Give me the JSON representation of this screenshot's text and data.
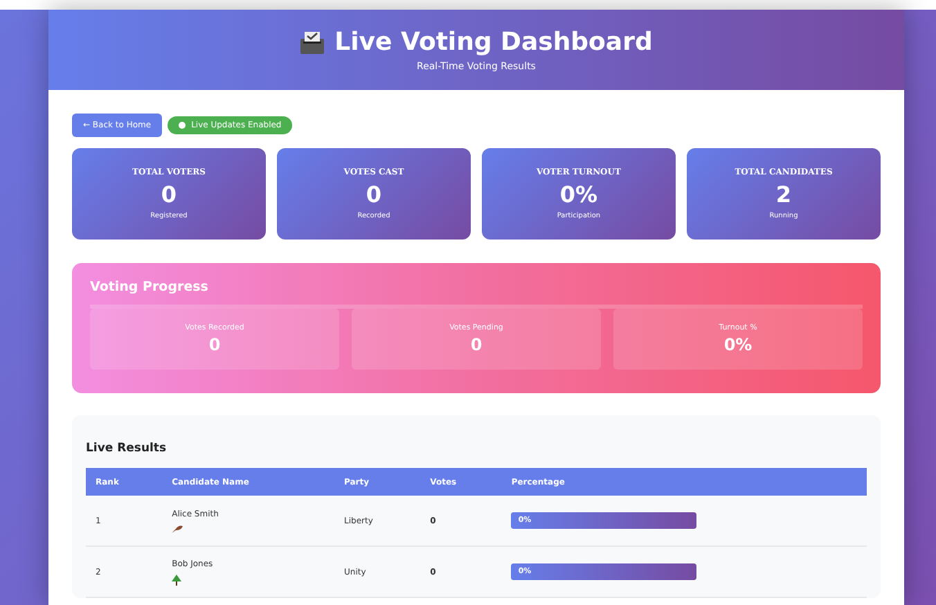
{
  "header": {
    "title": "Live Voting Dashboard",
    "subtitle": "Real-Time Voting Results"
  },
  "back_button": "← Back to Home",
  "live_badge": {
    "label": "Live Updates Enabled",
    "on": true
  },
  "stats": [
    {
      "label": "TOTAL VOTERS",
      "value": "0",
      "caption": "Registered"
    },
    {
      "label": "VOTES CAST",
      "value": "0",
      "caption": "Recorded"
    },
    {
      "label": "VOTER TURNOUT",
      "value": "0%",
      "caption": "Participation"
    },
    {
      "label": "TOTAL CANDIDATES",
      "value": "2",
      "caption": "Running"
    }
  ],
  "progress": {
    "title": "Voting Progress",
    "items": [
      {
        "label": "Votes Recorded",
        "value": "0"
      },
      {
        "label": "Votes Pending",
        "value": "0"
      },
      {
        "label": "Turnout %",
        "value": "0%"
      }
    ]
  },
  "results": {
    "title": "Live Results",
    "columns": [
      "Rank",
      "Candidate Name",
      "Party",
      "Votes",
      "Percentage"
    ],
    "rows": [
      {
        "rank": "1",
        "name": "Alice Smith",
        "kind": "feather",
        "party": "Liberty",
        "votes": "0",
        "percentage": "0%"
      },
      {
        "rank": "2",
        "name": "Bob Jones",
        "kind": "tree",
        "party": "Unity",
        "votes": "0",
        "percentage": "0%"
      }
    ]
  }
}
